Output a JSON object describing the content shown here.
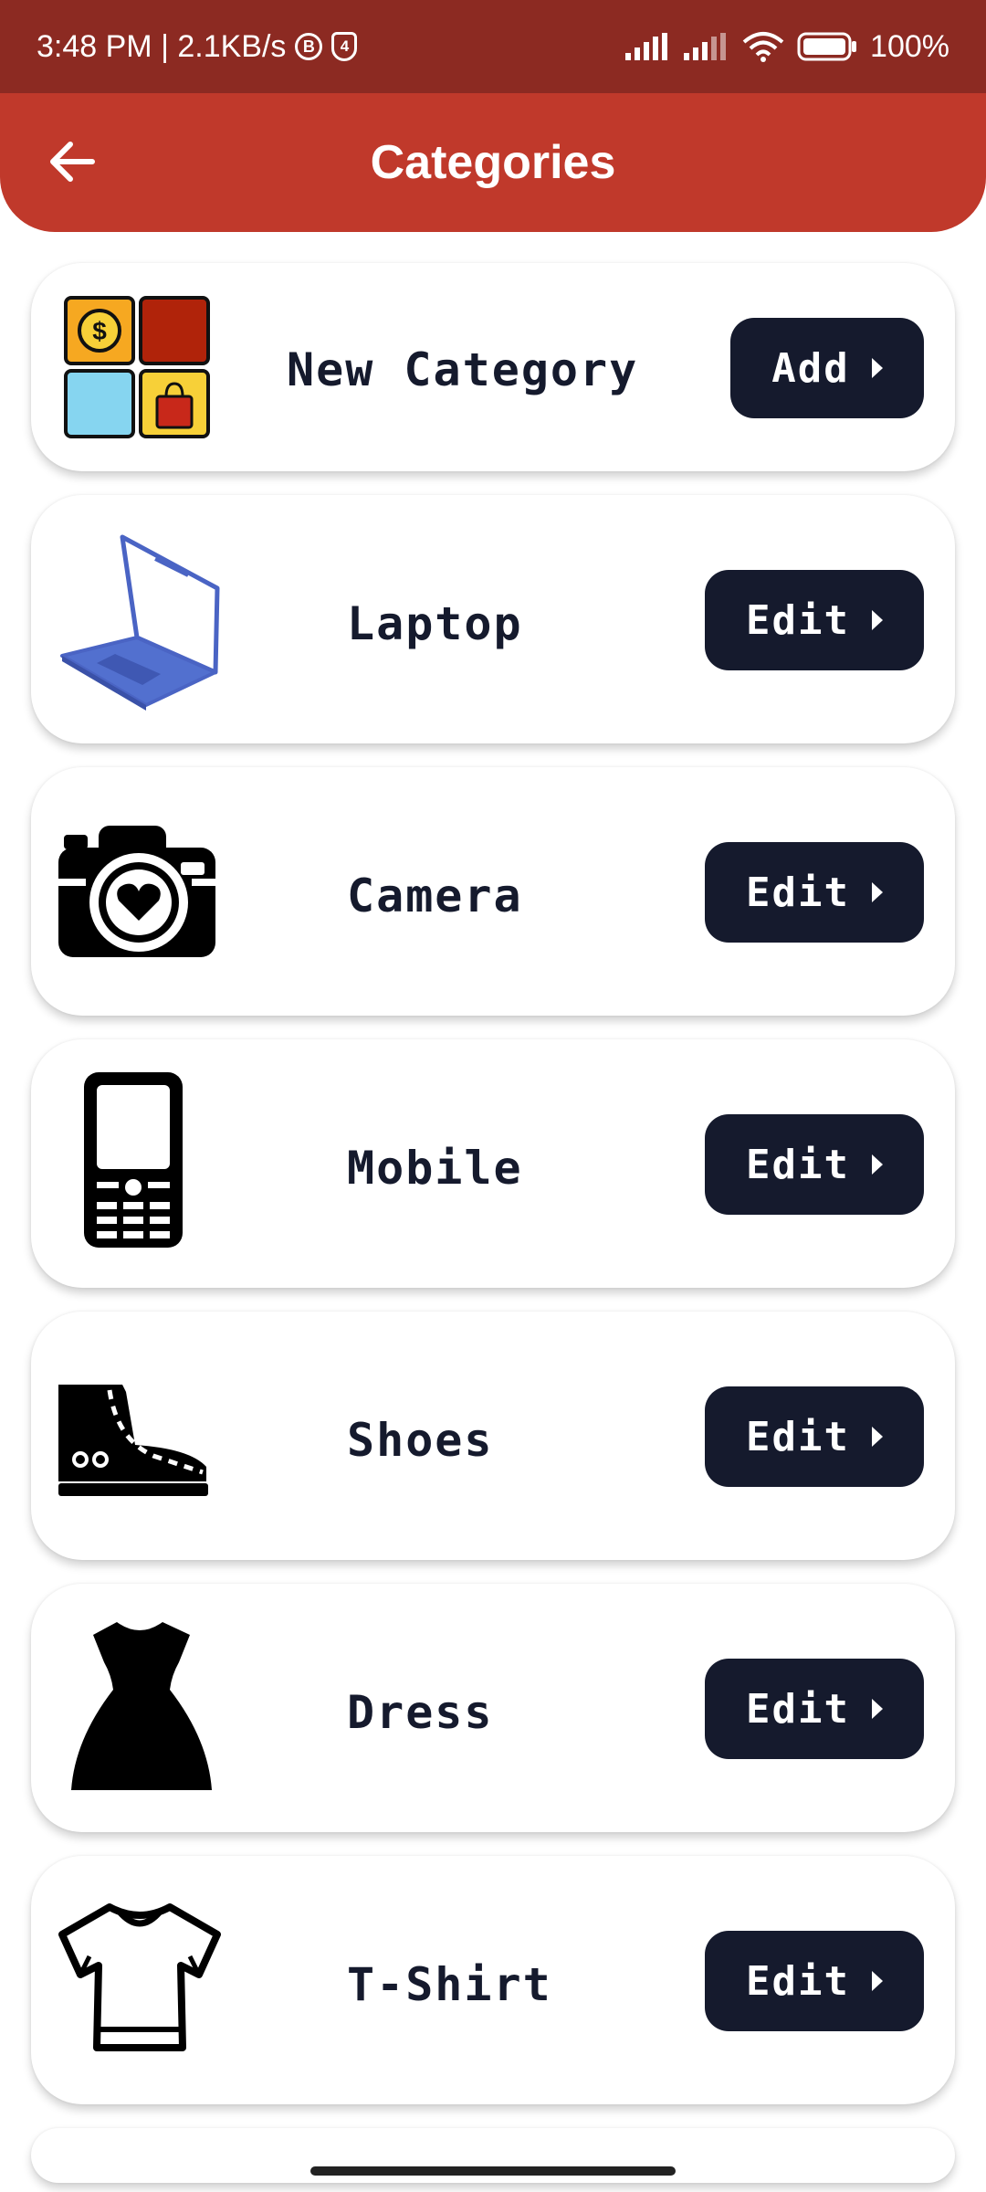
{
  "status_bar": {
    "time_speed": "3:48 PM | 2.1KB/s",
    "badge_b": "B",
    "badge_shield": "4",
    "battery": "100%"
  },
  "app_bar": {
    "title": "Categories",
    "back_icon": "arrow-left-icon"
  },
  "categories": [
    {
      "label": "New Category",
      "button": "Add",
      "icon": "new-category-grid-icon"
    },
    {
      "label": "Laptop",
      "button": "Edit",
      "icon": "laptop-icon"
    },
    {
      "label": "Camera",
      "button": "Edit",
      "icon": "camera-icon"
    },
    {
      "label": "Mobile",
      "button": "Edit",
      "icon": "mobile-phone-icon"
    },
    {
      "label": "Shoes",
      "button": "Edit",
      "icon": "shoe-icon"
    },
    {
      "label": "Dress",
      "button": "Edit",
      "icon": "dress-icon"
    },
    {
      "label": "T-Shirt",
      "button": "Edit",
      "icon": "tshirt-icon"
    }
  ],
  "colors": {
    "status_bar": "#8c2a22",
    "app_bar": "#c0392b",
    "button": "#151a2d",
    "label": "#151a2d"
  }
}
